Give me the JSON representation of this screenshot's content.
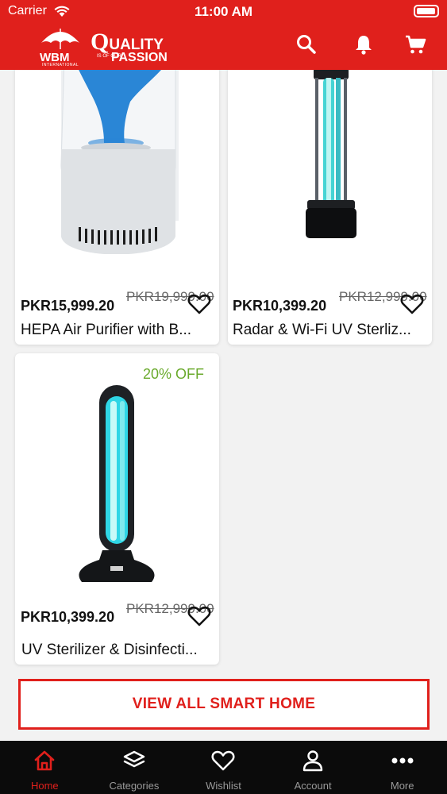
{
  "status_bar": {
    "carrier": "Carrier",
    "time": "11:00 AM"
  },
  "header": {
    "logo_text": "WBM",
    "logo_sub": "INTERNATIONAL",
    "tagline_q": "Q",
    "tagline_uality": "UALITY",
    "tagline_of": "IS OF OUR",
    "tagline_passion": "PASSION",
    "icons": [
      "search-icon",
      "bell-icon",
      "cart-icon"
    ]
  },
  "products": [
    {
      "price": "PKR15,999.20",
      "old_price": "PKR19,999.00",
      "name": "HEPA Air Purifier with B...",
      "discount": ""
    },
    {
      "price": "PKR10,399.20",
      "old_price": "PKR12,999.00",
      "name": "Radar & Wi-Fi UV Sterliz...",
      "discount": ""
    },
    {
      "price": "PKR10,399.20",
      "old_price": "PKR12,999.00",
      "name": "UV Sterilizer & Disinfecti...",
      "discount": "20% OFF"
    }
  ],
  "view_all_label": "VIEW ALL SMART HOME",
  "tabs": [
    {
      "label": "Home",
      "icon": "home-icon",
      "active": true
    },
    {
      "label": "Categories",
      "icon": "layers-icon",
      "active": false
    },
    {
      "label": "Wishlist",
      "icon": "heart-icon",
      "active": false
    },
    {
      "label": "Account",
      "icon": "user-icon",
      "active": false
    },
    {
      "label": "More",
      "icon": "more-icon",
      "active": false
    }
  ],
  "colors": {
    "brand": "#e0201c",
    "discount": "#6aaa2c",
    "tabbar": "#0b0b0b"
  }
}
